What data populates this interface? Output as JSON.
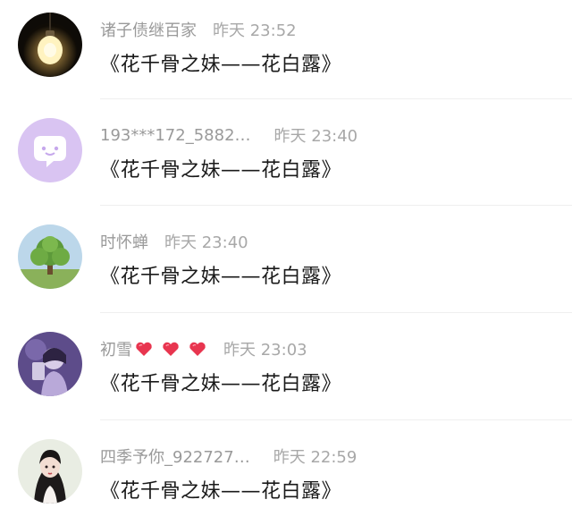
{
  "comments": [
    {
      "user": "诸子债继百家",
      "time": "昨天 23:52",
      "text": "《花千骨之妹——花白露》",
      "avatar": "lightbulb-avatar"
    },
    {
      "user": "193***172_5882…",
      "time": "昨天 23:40",
      "text": "《花千骨之妹——花白露》",
      "avatar": "chat-bubble-avatar"
    },
    {
      "user": "时怀蝉",
      "time": "昨天 23:40",
      "text": "《花千骨之妹——花白露》",
      "avatar": "tree-avatar"
    },
    {
      "user": "初雪",
      "time": "昨天 23:03",
      "text": "《花千骨之妹——花白露》",
      "avatar": "girl-photo-avatar",
      "badges": [
        "heart-icon",
        "heart-icon",
        "heart-icon"
      ]
    },
    {
      "user": "四季予你_922727…",
      "time": "昨天 22:59",
      "text": "《花千骨之妹——花白露》",
      "avatar": "anime-girl-avatar"
    }
  ],
  "colors": {
    "name": "#9a9a9a",
    "time": "#a8a8a8",
    "text": "#1a1a1a",
    "heart": "#e8354f"
  }
}
